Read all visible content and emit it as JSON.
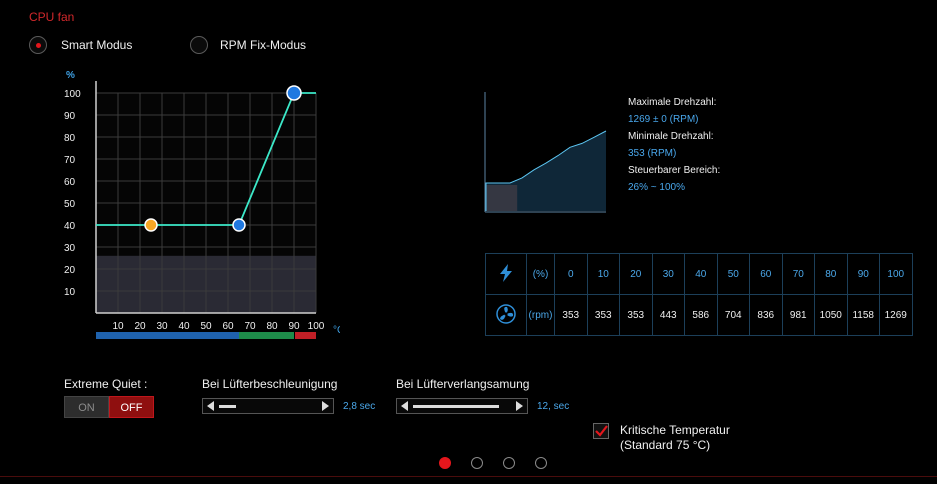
{
  "title": "CPU fan",
  "modes": {
    "smart": "Smart Modus",
    "fixed": "RPM Fix-Modus",
    "selected": "smart"
  },
  "curve": {
    "y_unit": "%",
    "x_unit": "°C",
    "y_ticks": [
      "100",
      "90",
      "80",
      "70",
      "60",
      "50",
      "40",
      "30",
      "20",
      "10"
    ],
    "x_ticks": [
      "10",
      "20",
      "30",
      "40",
      "50",
      "60",
      "70",
      "80",
      "90",
      "100"
    ],
    "points": [
      [
        25,
        40
      ],
      [
        65,
        40
      ],
      [
        90,
        100
      ]
    ],
    "min_band_percent": 26,
    "temp_zones": {
      "blue_end": 65,
      "green_end": 90
    },
    "colors": {
      "line": "#3ce8c8",
      "point": "#1f78e0",
      "point_orange": "#f5a623",
      "zone_blue": "#1f62ad",
      "zone_green": "#1e8c4a",
      "zone_red": "#c01f26"
    }
  },
  "info": {
    "max_label": "Maximale Drehzahl:",
    "max_value": "1269 ± 0 (RPM)",
    "min_label": "Minimale Drehzahl:",
    "min_value": "353 (RPM)",
    "range_label": "Steuerbarer Bereich:",
    "range_value": "26% ~ 100%"
  },
  "rpm_curve": [
    353,
    353,
    353,
    443,
    586,
    704,
    836,
    981,
    1050,
    1158,
    1269
  ],
  "table": {
    "pct_unit": "(%)",
    "rpm_unit": "(rpm)",
    "percents": [
      "0",
      "10",
      "20",
      "30",
      "40",
      "50",
      "60",
      "70",
      "80",
      "90",
      "100"
    ],
    "rpms": [
      "353",
      "353",
      "353",
      "443",
      "586",
      "704",
      "836",
      "981",
      "1050",
      "1158",
      "1269"
    ]
  },
  "extreme_quiet": {
    "label": "Extreme Quiet :",
    "on": "ON",
    "off": "OFF",
    "state": "off"
  },
  "accel": {
    "label": "Bei Lüfterbeschleunigung",
    "value": "2,8 sec",
    "fraction": 0.17
  },
  "decel": {
    "label": "Bei Lüfterverlangsamung",
    "value": "12, sec",
    "fraction": 0.86
  },
  "critical": {
    "line1": "Kritische Temperatur",
    "line2": "(Standard 75 °C)",
    "checked": true
  },
  "pagination": {
    "count": 4,
    "active": 0
  }
}
